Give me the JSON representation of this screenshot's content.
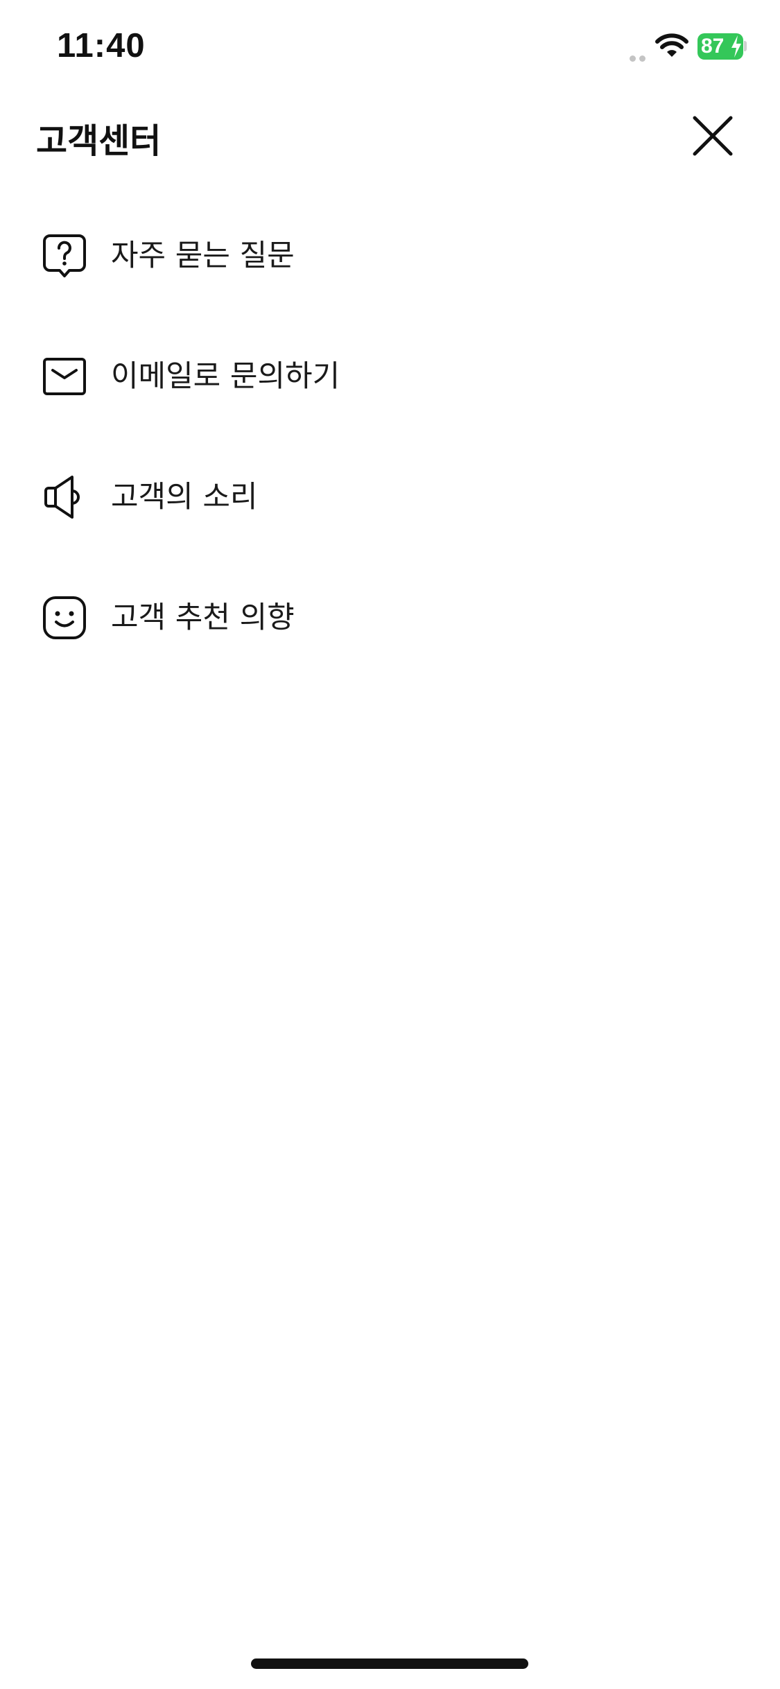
{
  "status_bar": {
    "time": "11:40",
    "battery_percent": "87",
    "battery_color": "#34c759",
    "charging": true
  },
  "header": {
    "title": "고객센터",
    "close_icon": "close-icon"
  },
  "menu": {
    "items": [
      {
        "label": "자주 묻는 질문",
        "icon": "question-bubble-icon"
      },
      {
        "label": "이메일로 문의하기",
        "icon": "mail-icon"
      },
      {
        "label": "고객의 소리",
        "icon": "megaphone-icon"
      },
      {
        "label": "고객 추천 의향",
        "icon": "smile-face-icon"
      }
    ]
  }
}
